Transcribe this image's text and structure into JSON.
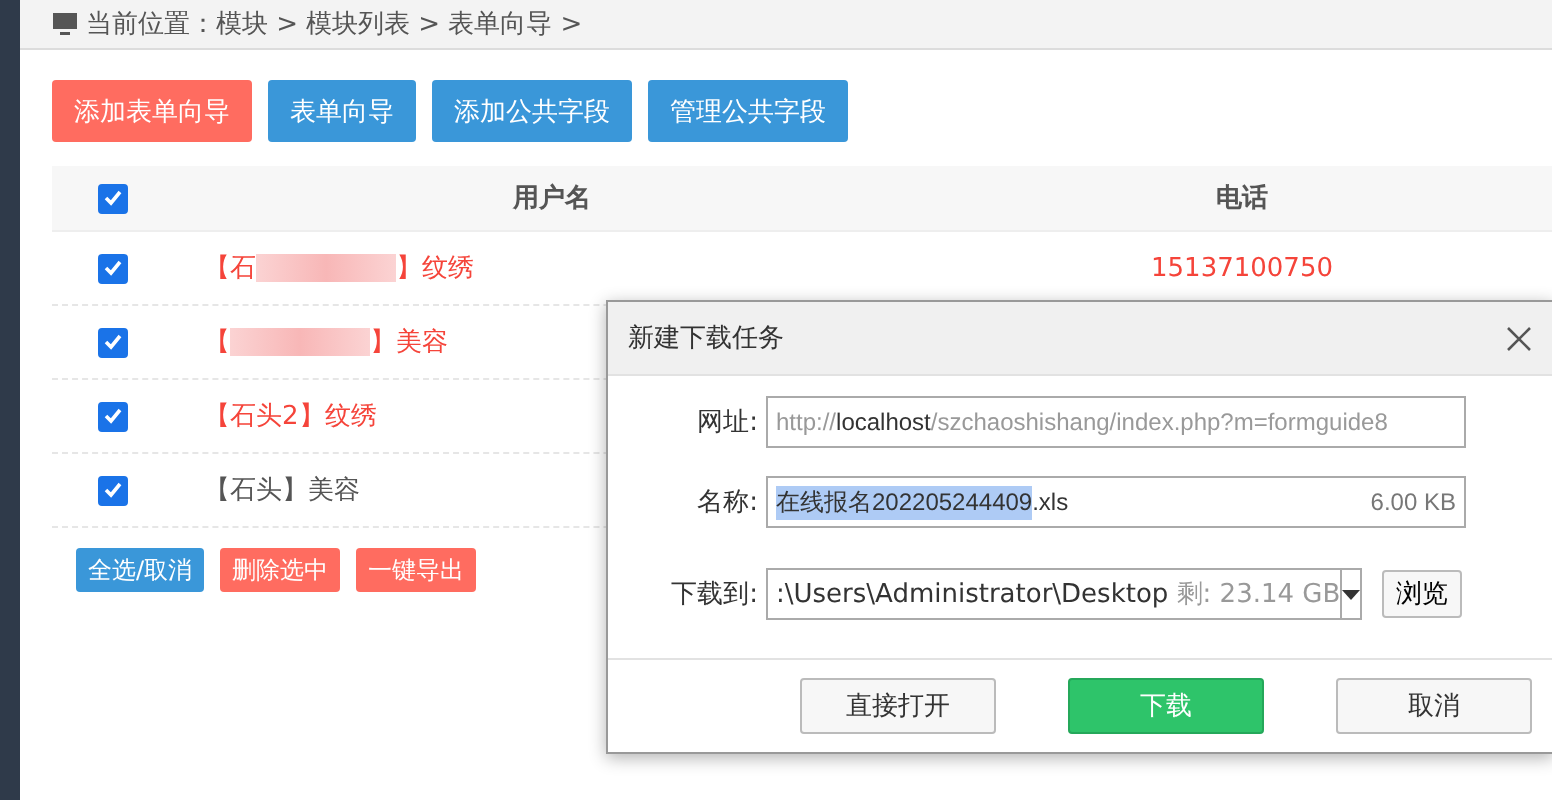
{
  "breadcrumb": {
    "items": [
      "当前位置：模块 >",
      "模块列表 >",
      "表单向导 >"
    ]
  },
  "toolbar": [
    {
      "label": "添加表单向导",
      "kind": "danger"
    },
    {
      "label": "表单向导",
      "kind": "primary"
    },
    {
      "label": "添加公共字段",
      "kind": "primary"
    },
    {
      "label": "管理公共字段",
      "kind": "primary"
    }
  ],
  "table": {
    "select_all_checked": true,
    "columns": [
      "用户名",
      "电话"
    ],
    "rows": [
      {
        "checked": true,
        "highlight": true,
        "name_start": "【石",
        "blurred": true,
        "name_end": "】纹绣",
        "phone": "15137100750"
      },
      {
        "checked": true,
        "highlight": true,
        "name_start": "【",
        "blurred": true,
        "name_end": "】美容",
        "phone": ""
      },
      {
        "checked": true,
        "highlight": true,
        "name_start": "【石头2】纹绣",
        "blurred": false,
        "name_end": "",
        "phone": ""
      },
      {
        "checked": true,
        "highlight": false,
        "name_start": "【石头】美容",
        "blurred": false,
        "name_end": "",
        "phone": ""
      }
    ]
  },
  "bottom_buttons": [
    {
      "label": "全选/取消",
      "kind": "primary"
    },
    {
      "label": "删除选中",
      "kind": "danger"
    },
    {
      "label": "一键导出",
      "kind": "danger"
    }
  ],
  "dialog": {
    "title": "新建下载任务",
    "url_label": "网址:",
    "url_before": "http://",
    "url_host": "localhost",
    "url_after": "/szchaoshishang/index.php?m=formguide8",
    "name_label": "名称:",
    "name_selected": "在线报名202205244409",
    "name_rest": ".xls",
    "size": "6.00 KB",
    "dest_label": "下载到:",
    "dest_path": ":\\Users\\Administrator\\Desktop",
    "free_space": "剩: 23.14 GB",
    "browse": "浏览",
    "buttons": [
      {
        "label": "直接打开",
        "kind": "default"
      },
      {
        "label": "下载",
        "kind": "primary"
      },
      {
        "label": "取消",
        "kind": "default"
      }
    ]
  }
}
